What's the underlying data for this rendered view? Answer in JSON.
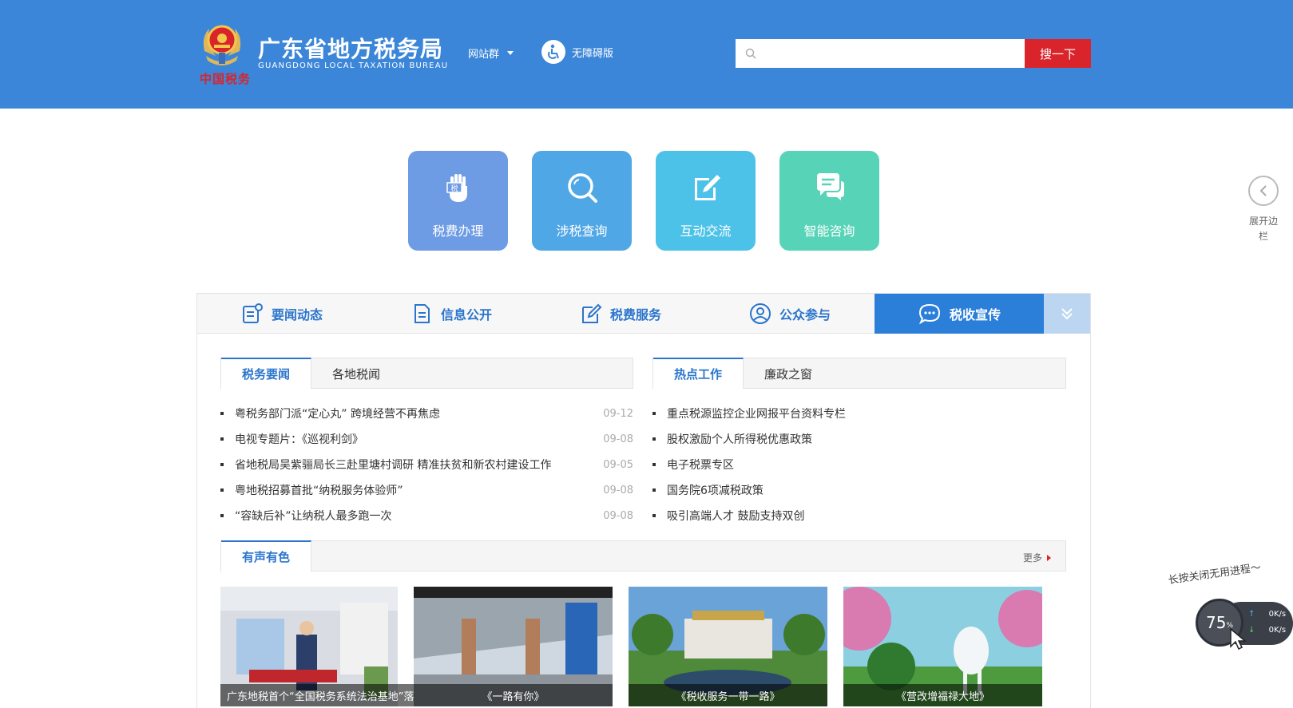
{
  "header": {
    "logo_sub": "中国税务",
    "title": "广东省地方税务局",
    "title_en": "GUANGDONG LOCAL TAXATION BUREAU",
    "site_group": "网站群",
    "accessibility": "无障碍版",
    "search_placeholder": "",
    "search_button": "搜一下",
    "brand_color": "#3b86d8",
    "accent_color": "#d9242b"
  },
  "tiles": [
    {
      "label": "税费办理",
      "icon": "tax-hand-icon",
      "badge": "税"
    },
    {
      "label": "涉税查询",
      "icon": "magnifier-icon"
    },
    {
      "label": "互动交流",
      "icon": "edit-icon"
    },
    {
      "label": "智能咨询",
      "icon": "chat-bubbles-icon"
    }
  ],
  "sidebar_toggle": {
    "label": "展开边栏"
  },
  "nav": {
    "items": [
      {
        "label": "要闻动态",
        "icon": "news-icon"
      },
      {
        "label": "信息公开",
        "icon": "document-icon"
      },
      {
        "label": "税费服务",
        "icon": "edit-icon"
      },
      {
        "label": "公众参与",
        "icon": "person-icon"
      },
      {
        "label": "税收宣传",
        "icon": "chat-icon",
        "active": true
      }
    ]
  },
  "left_tabs": [
    "税务要闻",
    "各地税闻"
  ],
  "left_news": [
    {
      "title": "粤税务部门派“定心丸” 跨境经营不再焦虑",
      "date": "09-12"
    },
    {
      "title": "电视专题片：《巡视利剑》",
      "date": "09-08"
    },
    {
      "title": "省地税局吴紫骊局长三赴里塘村调研 精准扶贫和新农村建设工作",
      "date": "09-05"
    },
    {
      "title": "粤地税招募首批“纳税服务体验师”",
      "date": "09-08"
    },
    {
      "title": "“容缺后补”让纳税人最多跑一次",
      "date": "09-08"
    }
  ],
  "right_tabs": [
    "热点工作",
    "廉政之窗"
  ],
  "right_news": [
    "重点税源监控企业网报平台资料专栏",
    "股权激励个人所得税优惠政策",
    "电子税票专区",
    "国务院6项减税政策",
    "吸引高端人才 鼓励支持双创"
  ],
  "media": {
    "tab": "有声有色",
    "more": "更多",
    "videos": [
      {
        "caption": "广东地税首个“全国税务系统法治基地”落户珠海"
      },
      {
        "caption": "《一路有你》"
      },
      {
        "caption": "《税收服务一带一路》"
      },
      {
        "caption": "《营改增福禄大地》"
      }
    ]
  },
  "speed_widget": {
    "hint": "长按关闭无用进程～",
    "percent": "75",
    "percent_unit": "%",
    "up": "0K/s",
    "down": "0K/s"
  }
}
